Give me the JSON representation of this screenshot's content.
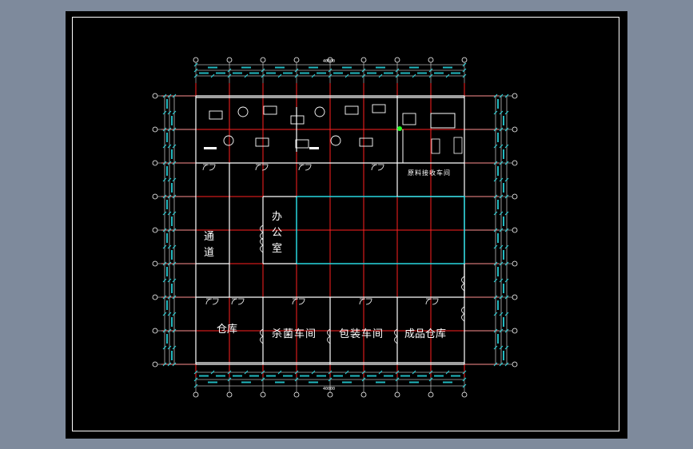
{
  "drawing": {
    "background": "#000000",
    "grid_color": "#ff2020",
    "wall_color": "#ffffff",
    "dim_color": "#28d8e0",
    "marker_color": "#22ff22"
  },
  "rooms": {
    "raw_material": "原料接收车间",
    "passage_1": "通",
    "passage_2": "道",
    "office_1": "办",
    "office_2": "公",
    "office_3": "室",
    "warehouse": "仓库",
    "sterilization": "杀菌车间",
    "packaging": "包装车间",
    "finished_goods": "成品仓库"
  },
  "dimensions": {
    "top_total": "40000",
    "bottom_total": "40000",
    "bay_span": "5000"
  }
}
